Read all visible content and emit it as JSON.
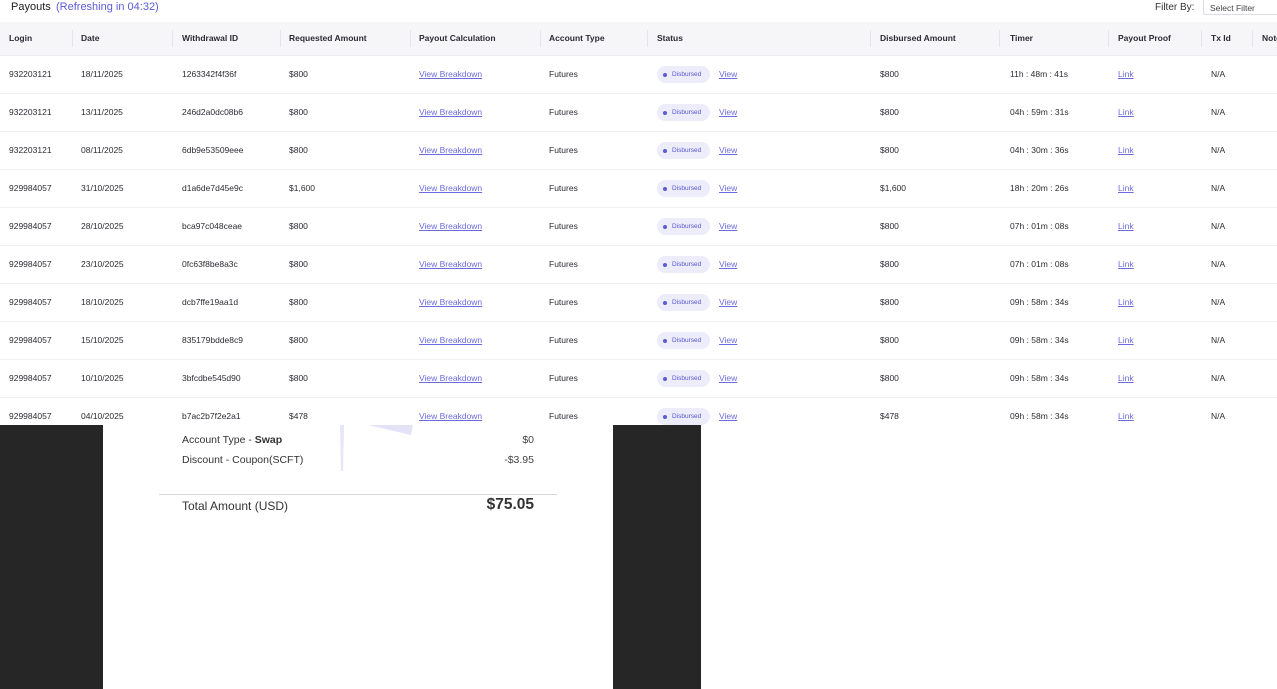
{
  "header": {
    "title": "Payouts",
    "refresh_text": "(Refreshing in 04:32)",
    "filter_label": "Filter By:",
    "filter_placeholder": "Select Filter"
  },
  "table": {
    "columns": [
      "Login",
      "Date",
      "Withdrawal ID",
      "Requested Amount",
      "Payout Calculation",
      "Account Type",
      "Status",
      "Disbursed Amount",
      "Timer",
      "Payout Proof",
      "Tx Id",
      "Note"
    ],
    "rows": [
      {
        "login": "932203121",
        "date": "18/11/2025",
        "withdrawal_id": "1263342f4f36f",
        "requested": "$800",
        "calc": "View Breakdown",
        "account_type": "Futures",
        "status": "Disbursed",
        "status_link": "View",
        "disbursed": "$800",
        "timer": "11h : 48m : 41s",
        "proof": "Link",
        "txid": "N/A"
      },
      {
        "login": "932203121",
        "date": "13/11/2025",
        "withdrawal_id": "246d2a0dc08b6",
        "requested": "$800",
        "calc": "View Breakdown",
        "account_type": "Futures",
        "status": "Disbursed",
        "status_link": "View",
        "disbursed": "$800",
        "timer": "04h : 59m : 31s",
        "proof": "Link",
        "txid": "N/A"
      },
      {
        "login": "932203121",
        "date": "08/11/2025",
        "withdrawal_id": "6db9e53509eee",
        "requested": "$800",
        "calc": "View Breakdown",
        "account_type": "Futures",
        "status": "Disbursed",
        "status_link": "View",
        "disbursed": "$800",
        "timer": "04h : 30m : 36s",
        "proof": "Link",
        "txid": "N/A"
      },
      {
        "login": "929984057",
        "date": "31/10/2025",
        "withdrawal_id": "d1a6de7d45e9c",
        "requested": "$1,600",
        "calc": "View Breakdown",
        "account_type": "Futures",
        "status": "Disbursed",
        "status_link": "View",
        "disbursed": "$1,600",
        "timer": "18h : 20m : 26s",
        "proof": "Link",
        "txid": "N/A"
      },
      {
        "login": "929984057",
        "date": "28/10/2025",
        "withdrawal_id": "bca97c048ceae",
        "requested": "$800",
        "calc": "View Breakdown",
        "account_type": "Futures",
        "status": "Disbursed",
        "status_link": "View",
        "disbursed": "$800",
        "timer": "07h : 01m : 08s",
        "proof": "Link",
        "txid": "N/A"
      },
      {
        "login": "929984057",
        "date": "23/10/2025",
        "withdrawal_id": "0fc63f8be8a3c",
        "requested": "$800",
        "calc": "View Breakdown",
        "account_type": "Futures",
        "status": "Disbursed",
        "status_link": "View",
        "disbursed": "$800",
        "timer": "07h : 01m : 08s",
        "proof": "Link",
        "txid": "N/A"
      },
      {
        "login": "929984057",
        "date": "18/10/2025",
        "withdrawal_id": "dcb7ffe19aa1d",
        "requested": "$800",
        "calc": "View Breakdown",
        "account_type": "Futures",
        "status": "Disbursed",
        "status_link": "View",
        "disbursed": "$800",
        "timer": "09h : 58m : 34s",
        "proof": "Link",
        "txid": "N/A"
      },
      {
        "login": "929984057",
        "date": "15/10/2025",
        "withdrawal_id": "835179bdde8c9",
        "requested": "$800",
        "calc": "View Breakdown",
        "account_type": "Futures",
        "status": "Disbursed",
        "status_link": "View",
        "disbursed": "$800",
        "timer": "09h : 58m : 34s",
        "proof": "Link",
        "txid": "N/A"
      },
      {
        "login": "929984057",
        "date": "10/10/2025",
        "withdrawal_id": "3bfcdbe545d90",
        "requested": "$800",
        "calc": "View Breakdown",
        "account_type": "Futures",
        "status": "Disbursed",
        "status_link": "View",
        "disbursed": "$800",
        "timer": "09h : 58m : 34s",
        "proof": "Link",
        "txid": "N/A"
      },
      {
        "login": "929984057",
        "date": "04/10/2025",
        "withdrawal_id": "b7ac2b7f2e2a1",
        "requested": "$478",
        "calc": "View Breakdown",
        "account_type": "Futures",
        "status": "Disbursed",
        "status_link": "View",
        "disbursed": "$478",
        "timer": "09h : 58m : 34s",
        "proof": "Link",
        "txid": "N/A"
      }
    ]
  },
  "summary": {
    "account_type_label": "Account Type - ",
    "account_type_value": "Swap",
    "account_type_amount": "$0",
    "discount_label": "Discount - Coupon(SCFT)",
    "discount_amount": "-$3.95",
    "total_label": "Total Amount (USD)",
    "total_amount": "$75.05"
  },
  "colors": {
    "accent": "#5b5bd6",
    "badge_bg": "#ececfb",
    "header_bg": "#f6f6f8",
    "dark_bg": "#262626"
  }
}
